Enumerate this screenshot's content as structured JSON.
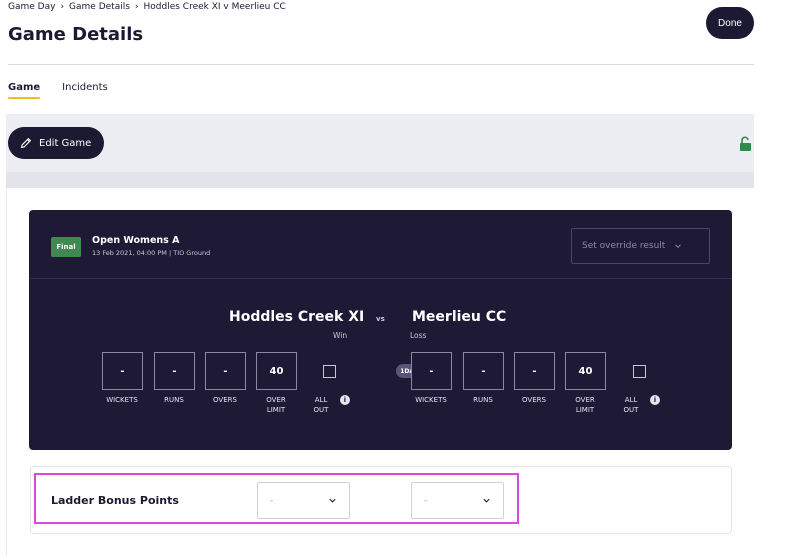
{
  "breadcrumb": [
    "Game Day",
    "Game Details",
    "Hoddles Creek XI v Meerlieu CC"
  ],
  "page_title": "Game Details",
  "done_label": "Done",
  "tabs": [
    {
      "label": "Game",
      "active": true
    },
    {
      "label": "Incidents",
      "active": false
    }
  ],
  "toolbar": {
    "edit_label": "Edit Game"
  },
  "game": {
    "status": "Final",
    "competition": "Open Womens A",
    "meta": "13 Feb 2021, 04:00 PM | TIO Ground",
    "override_placeholder": "Set override result",
    "vs_label": "vs",
    "format": "1DAY",
    "home": {
      "name": "Hoddles Creek XI",
      "result": "Win",
      "wickets": "-",
      "runs": "-",
      "overs": "-",
      "over_limit": "40"
    },
    "away": {
      "name": "Meerlieu CC",
      "result": "Loss",
      "wickets": "-",
      "runs": "-",
      "overs": "-",
      "over_limit": "40"
    },
    "labels": {
      "wickets": "WICKETS",
      "runs": "RUNS",
      "overs": "OVERS",
      "over": "OVER",
      "limit": "LIMIT",
      "all": "ALL",
      "out": "OUT"
    }
  },
  "ladder": {
    "label": "Ladder Bonus Points",
    "home_value": "-",
    "away_value": "-"
  },
  "colors": {
    "primary_dark": "#1c1a33",
    "card_bg": "#1e1a36",
    "final_badge": "#3f8a53",
    "tab_underline": "#f5b82e",
    "highlight": "#d84ad8",
    "lock_green": "#2e8b4a"
  },
  "icons": {
    "edit": "pencil-icon",
    "lock": "unlock-icon",
    "override_chevron": "chevron-down-icon",
    "info": "info-icon"
  }
}
